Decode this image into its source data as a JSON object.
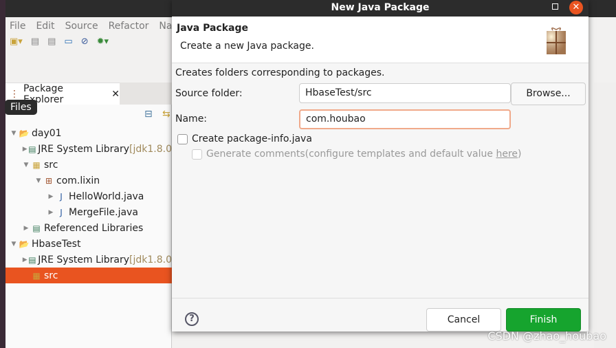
{
  "menu": [
    "File",
    "Edit",
    "Source",
    "Refactor",
    "Na"
  ],
  "package_explorer": {
    "tab_label": "Package Explorer",
    "tooltip": "Files",
    "tree": [
      {
        "label": "day01",
        "suffix": "",
        "level": 0,
        "twisty": "expanded",
        "icon": "project-folder-icon"
      },
      {
        "label": "JRE System Library ",
        "suffix": "[jdk1.8.0",
        "level": 1,
        "twisty": "collapsed",
        "icon": "library-icon"
      },
      {
        "label": "src",
        "suffix": "",
        "level": 1,
        "twisty": "expanded",
        "icon": "source-folder-icon"
      },
      {
        "label": "com.lixin",
        "suffix": "",
        "level": 2,
        "twisty": "expanded",
        "icon": "package-icon"
      },
      {
        "label": "HelloWorld.java",
        "suffix": "",
        "level": 3,
        "twisty": "collapsed",
        "icon": "java-file-icon"
      },
      {
        "label": "MergeFile.java",
        "suffix": "",
        "level": 3,
        "twisty": "collapsed",
        "icon": "java-file-icon"
      },
      {
        "label": "Referenced Libraries",
        "suffix": "",
        "level": 1,
        "twisty": "collapsed",
        "icon": "library-icon"
      },
      {
        "label": "HbaseTest",
        "suffix": "",
        "level": 0,
        "twisty": "expanded",
        "icon": "project-folder-warning-icon"
      },
      {
        "label": "JRE System Library ",
        "suffix": "[jdk1.8.0",
        "level": 1,
        "twisty": "collapsed",
        "icon": "library-icon"
      },
      {
        "label": "src",
        "suffix": "",
        "level": 1,
        "twisty": "none",
        "icon": "source-folder-icon",
        "selected": true
      }
    ]
  },
  "dialog": {
    "window_title": "New Java Package",
    "header_title": "Java Package",
    "header_subtitle": "Create a new Java package.",
    "description": "Creates folders corresponding to packages.",
    "source_folder_label": "Source folder:",
    "source_folder_value": "HbaseTest/src",
    "browse_label": "Browse...",
    "name_label": "Name:",
    "name_value": "com.houbao",
    "create_package_info_label": "Create package-info.java",
    "create_package_info_checked": false,
    "generate_comments_label": "Generate comments(configure templates and default value ",
    "generate_comments_link": "here",
    "generate_comments_close": ")",
    "generate_comments_checked": false,
    "cancel_label": "Cancel",
    "finish_label": "Finish"
  },
  "colors": {
    "accent": "#e95420",
    "finish": "#16a42e",
    "titlebar": "#2c2c2c"
  },
  "watermark": "CSDN @zhao_houbao"
}
